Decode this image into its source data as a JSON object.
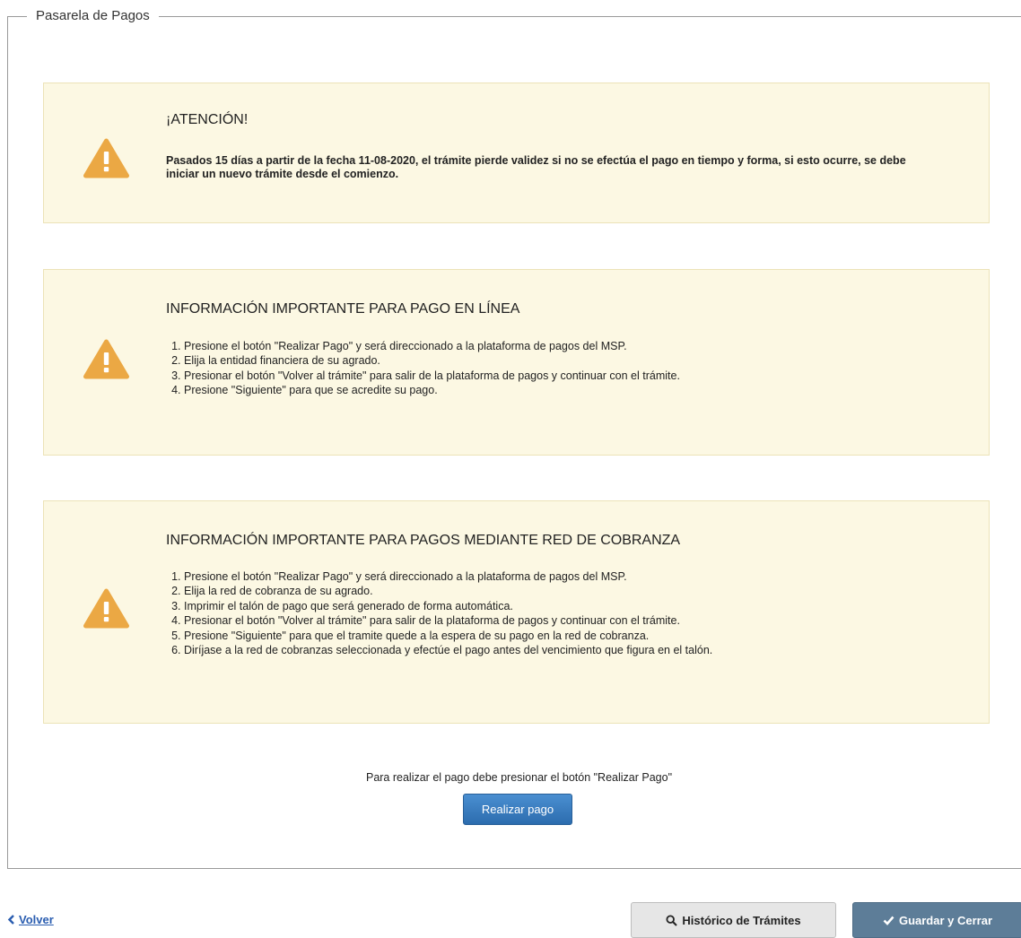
{
  "fieldset": {
    "legend": "Pasarela de Pagos"
  },
  "alerts": [
    {
      "title": "¡ATENCIÓN!",
      "body": "Pasados 15 días a partir de la fecha 11-08-2020, el trámite pierde validez si no se efectúa el pago en tiempo y forma, si esto ocurre, se debe iniciar un nuevo trámite desde el comienzo.",
      "icon": "warning-icon"
    },
    {
      "title": "INFORMACIÓN IMPORTANTE PARA PAGO EN LÍNEA",
      "icon": "warning-icon",
      "steps": [
        "Presione el botón \"Realizar Pago\" y será direccionado a la plataforma de pagos del MSP.",
        "Elija la entidad financiera de su agrado.",
        "Presionar el botón \"Volver al trámite\" para salir de la plataforma de pagos y continuar con el trámite.",
        "Presione \"Siguiente\" para que se acredite su pago."
      ]
    },
    {
      "title": "INFORMACIÓN IMPORTANTE PARA PAGOS MEDIANTE RED DE COBRANZA",
      "icon": "warning-icon",
      "steps": [
        "Presione el botón \"Realizar Pago\" y será direccionado a la plataforma de pagos del MSP.",
        "Elija la red de cobranza de su agrado.",
        "Imprimir el talón de pago que será generado de forma automática.",
        "Presionar el botón \"Volver al trámite\" para salir de la plataforma de pagos y continuar con el trámite.",
        "Presione \"Siguiente\" para que el tramite quede a la espera de su pago en la red de cobranza.",
        "Diríjase a la red de cobranzas seleccionada y efectúe el pago antes del vencimiento que figura en el talón."
      ]
    }
  ],
  "payment": {
    "instruction": "Para realizar el pago debe presionar el botón \"Realizar Pago\"",
    "button_label": "Realizar pago"
  },
  "footer": {
    "back_label": "Volver",
    "history_label": "Histórico de Trámites",
    "save_label": "Guardar y Cerrar"
  },
  "colors": {
    "alert_bg": "#fcf8e3",
    "warning_icon": "#eba844",
    "primary_button": "#337ab7",
    "save_button": "#5d7d98",
    "link": "#2a5db0"
  }
}
